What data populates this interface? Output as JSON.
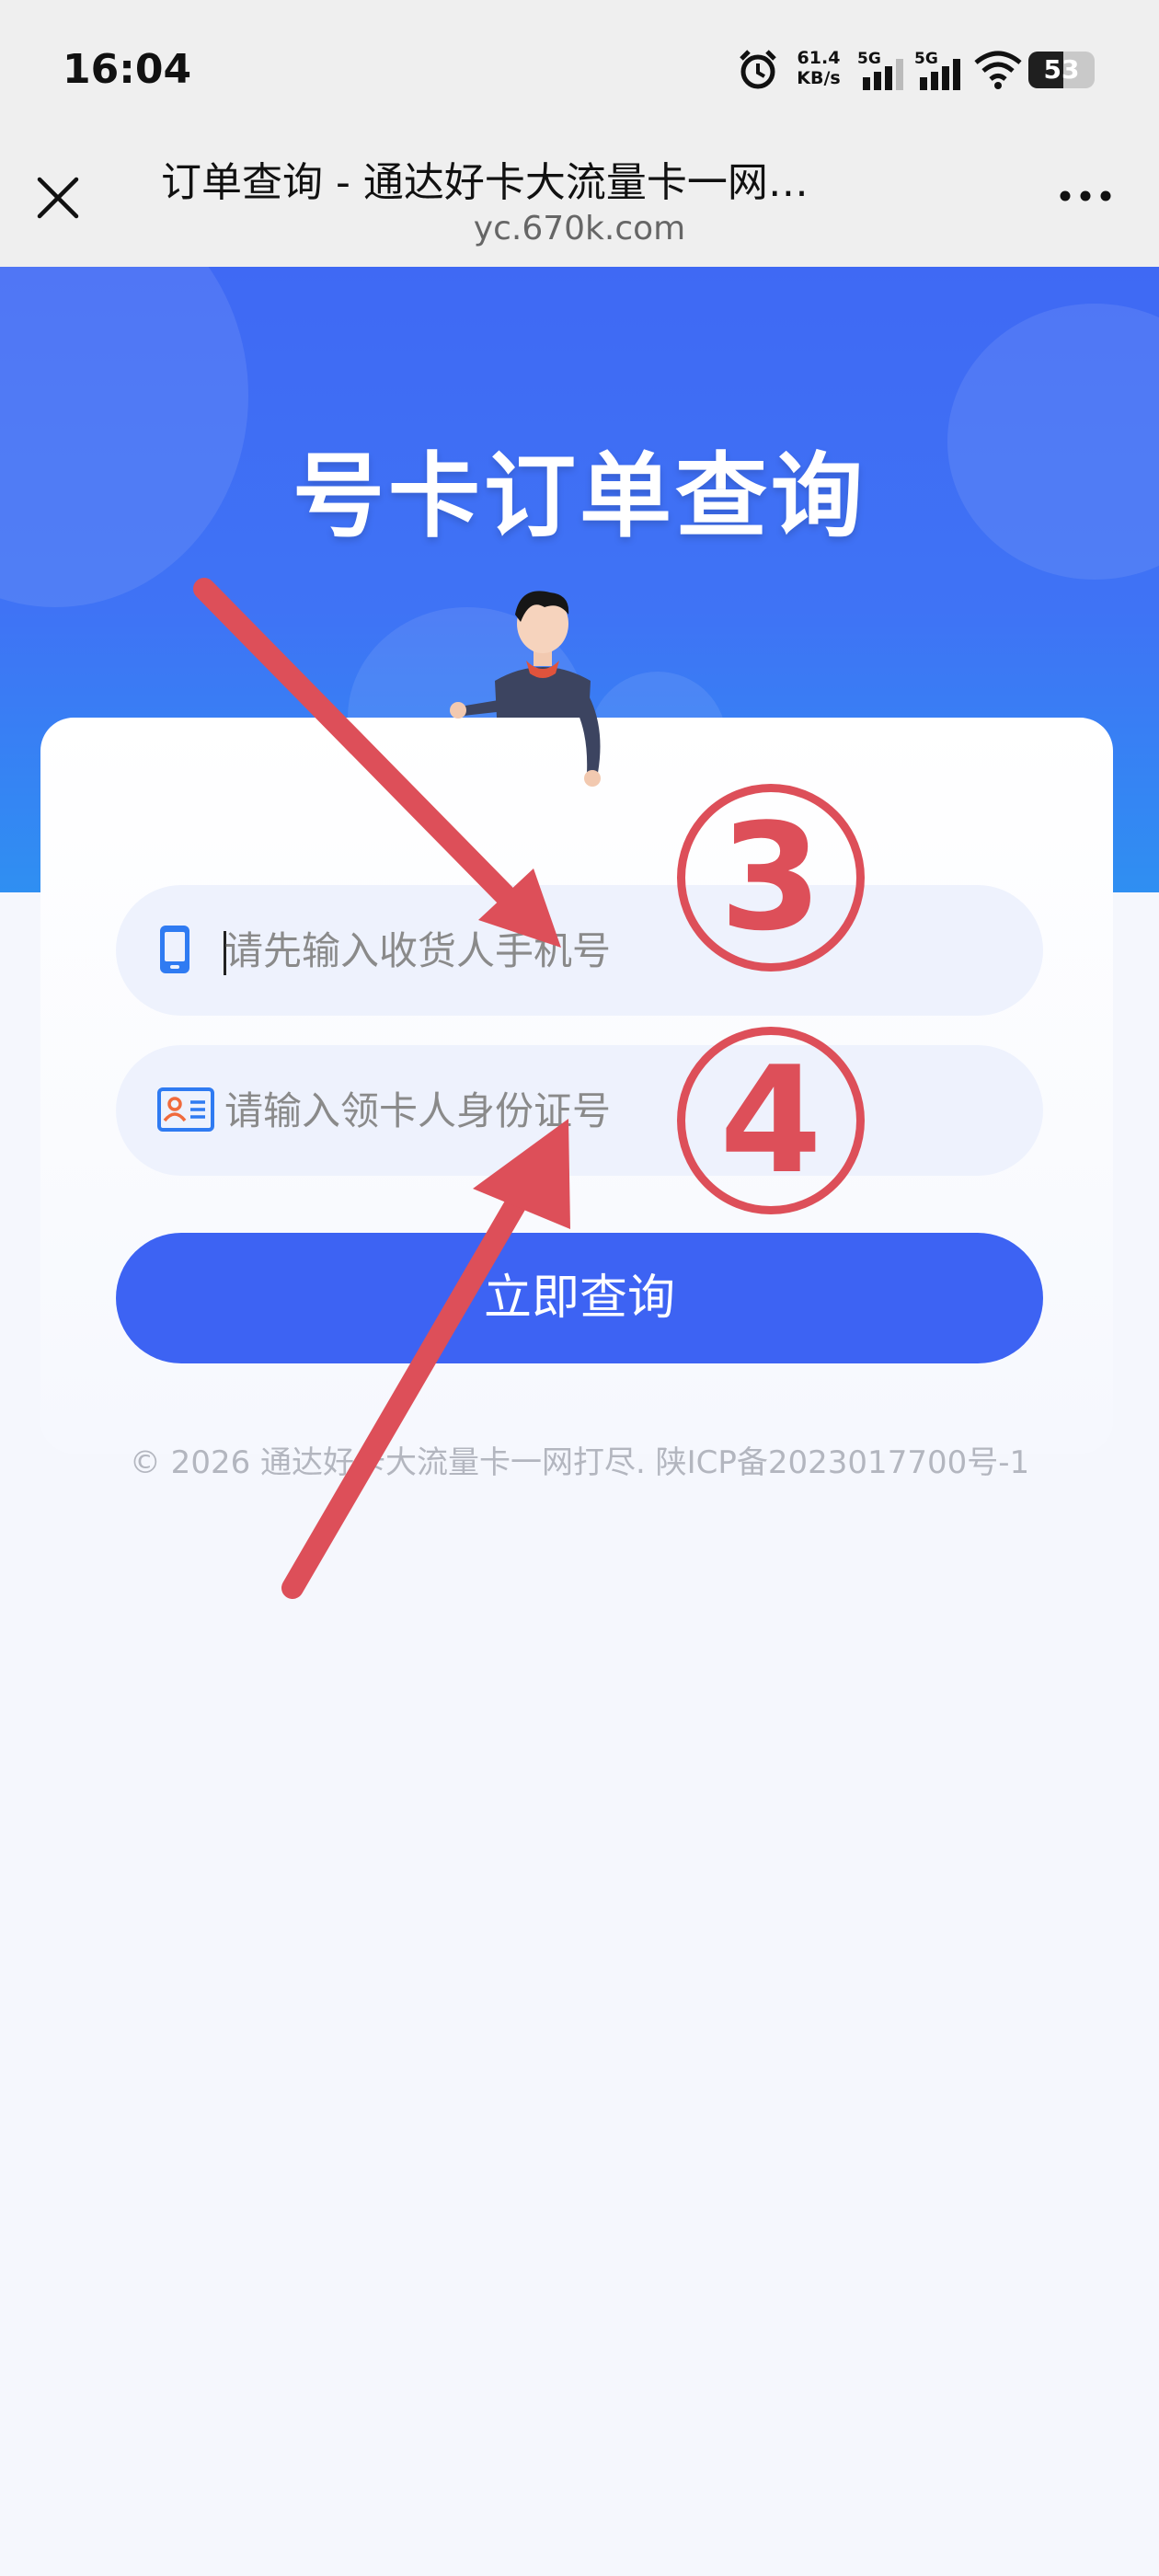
{
  "status_bar": {
    "time": "16:04",
    "network_speed": "61.4",
    "network_unit": "KB/s",
    "signal_1_label": "5G",
    "signal_2_label": "5G",
    "battery": "53"
  },
  "browser": {
    "title": "订单查询 - 通达好卡大流量卡一网…",
    "url": "yc.670k.com"
  },
  "hero": {
    "title": "号卡订单查询"
  },
  "form": {
    "phone_placeholder": "请先输入收货人手机号",
    "id_placeholder": "请输入领卡人身份证号",
    "submit_label": "立即查询"
  },
  "footer": {
    "text": "© 2026 通达好卡大流量卡一网打尽. 陕ICP备2023017700号-1"
  },
  "annotations": {
    "step_3": "③",
    "step_3_digit": "3",
    "step_4_digit": "4",
    "color": "#dd4f59"
  },
  "colors": {
    "primary": "#3d63f3",
    "hero_top": "#3f69f4",
    "hero_bottom": "#2f8ff2",
    "input_bg": "#eef2fd",
    "page_bg": "#f5f7fd"
  },
  "icons": [
    "close-icon",
    "more-icon",
    "alarm-icon",
    "signal-icon",
    "wifi-icon",
    "phone-icon",
    "id-card-icon",
    "person-illustration"
  ]
}
